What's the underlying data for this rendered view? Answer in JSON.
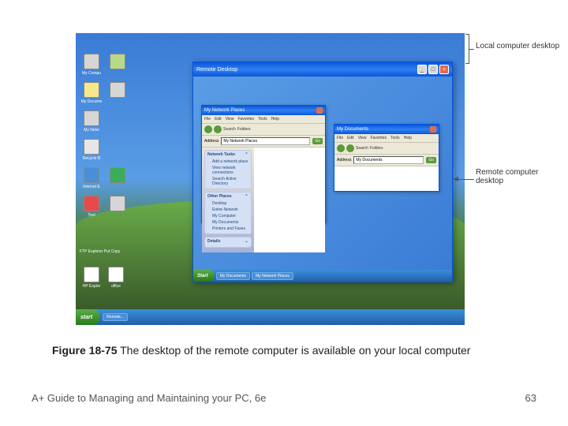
{
  "caption": {
    "figure_label": "Figure 18-75",
    "text": "The desktop of the remote computer is available on your local computer"
  },
  "footer": {
    "book_title": "A+ Guide to Managing and Maintaining your PC, 6e",
    "page_number": "63"
  },
  "annotations": {
    "local": "Local computer desktop",
    "remote": "Remote computer desktop"
  },
  "local_desktop": {
    "start_label": "start",
    "taskbar_item": "Remote..."
  },
  "remote_window": {
    "title": "Remote Desktop",
    "taskbar": {
      "start_label": "Start",
      "items": [
        "My Documents",
        "My Network Places"
      ]
    },
    "explorer1": {
      "title": "My Network Places",
      "menu": [
        "File",
        "Edit",
        "View",
        "Favorites",
        "Tools",
        "Help"
      ],
      "toolbar": {
        "search": "Search",
        "folders": "Folders"
      },
      "address_label": "Address",
      "address_value": "My Network Places",
      "go_label": "Go",
      "tasks": {
        "network_header": "Network Tasks",
        "network_items": [
          "Add a network place",
          "View network connections",
          "Search Active Directory"
        ],
        "places_header": "Other Places",
        "places_items": [
          "Desktop",
          "Entire Network",
          "My Computer",
          "My Documents",
          "Printers and Faxes"
        ],
        "details_header": "Details"
      }
    },
    "explorer2": {
      "title": "My Documents",
      "menu": [
        "File",
        "Edit",
        "View",
        "Favorites",
        "Tools",
        "Help"
      ],
      "toolbar": {
        "search": "Search",
        "folders": "Folders"
      },
      "address_label": "Address",
      "address_value": "My Documents",
      "go_label": "Go"
    }
  }
}
